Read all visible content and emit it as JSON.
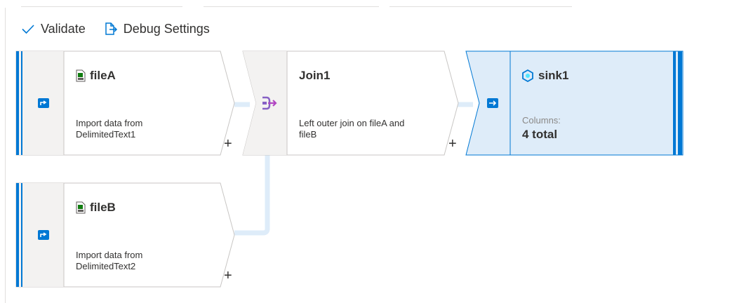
{
  "toolbar": {
    "validate_label": "Validate",
    "debug_settings_label": "Debug Settings"
  },
  "nodes": {
    "fileA": {
      "title": "fileA",
      "description_line1": "Import data from",
      "description_line2": "DelimitedText1",
      "add_label": "+"
    },
    "join1": {
      "title": "Join1",
      "description_line1": "Left outer join on fileA and",
      "description_line2": "fileB",
      "add_label": "+"
    },
    "sink1": {
      "title": "sink1",
      "columns_label": "Columns:",
      "columns_value": "4 total"
    },
    "fileB": {
      "title": "fileB",
      "description_line1": "Import data from",
      "description_line2": "DelimitedText2",
      "add_label": "+"
    }
  },
  "colors": {
    "accent": "#0078d4",
    "connector": "#deecf9",
    "selected_fill": "#deecf9",
    "icon_column": "#f3f2f1",
    "join_icon": "#8661c5"
  },
  "icons": {
    "validate": "checkmark-icon",
    "debug": "debug-settings-icon",
    "source": "source-icon",
    "csv": "csv-file-icon",
    "join": "join-icon",
    "sink": "sink-icon",
    "sink_title": "dataset-hexagon-icon"
  }
}
